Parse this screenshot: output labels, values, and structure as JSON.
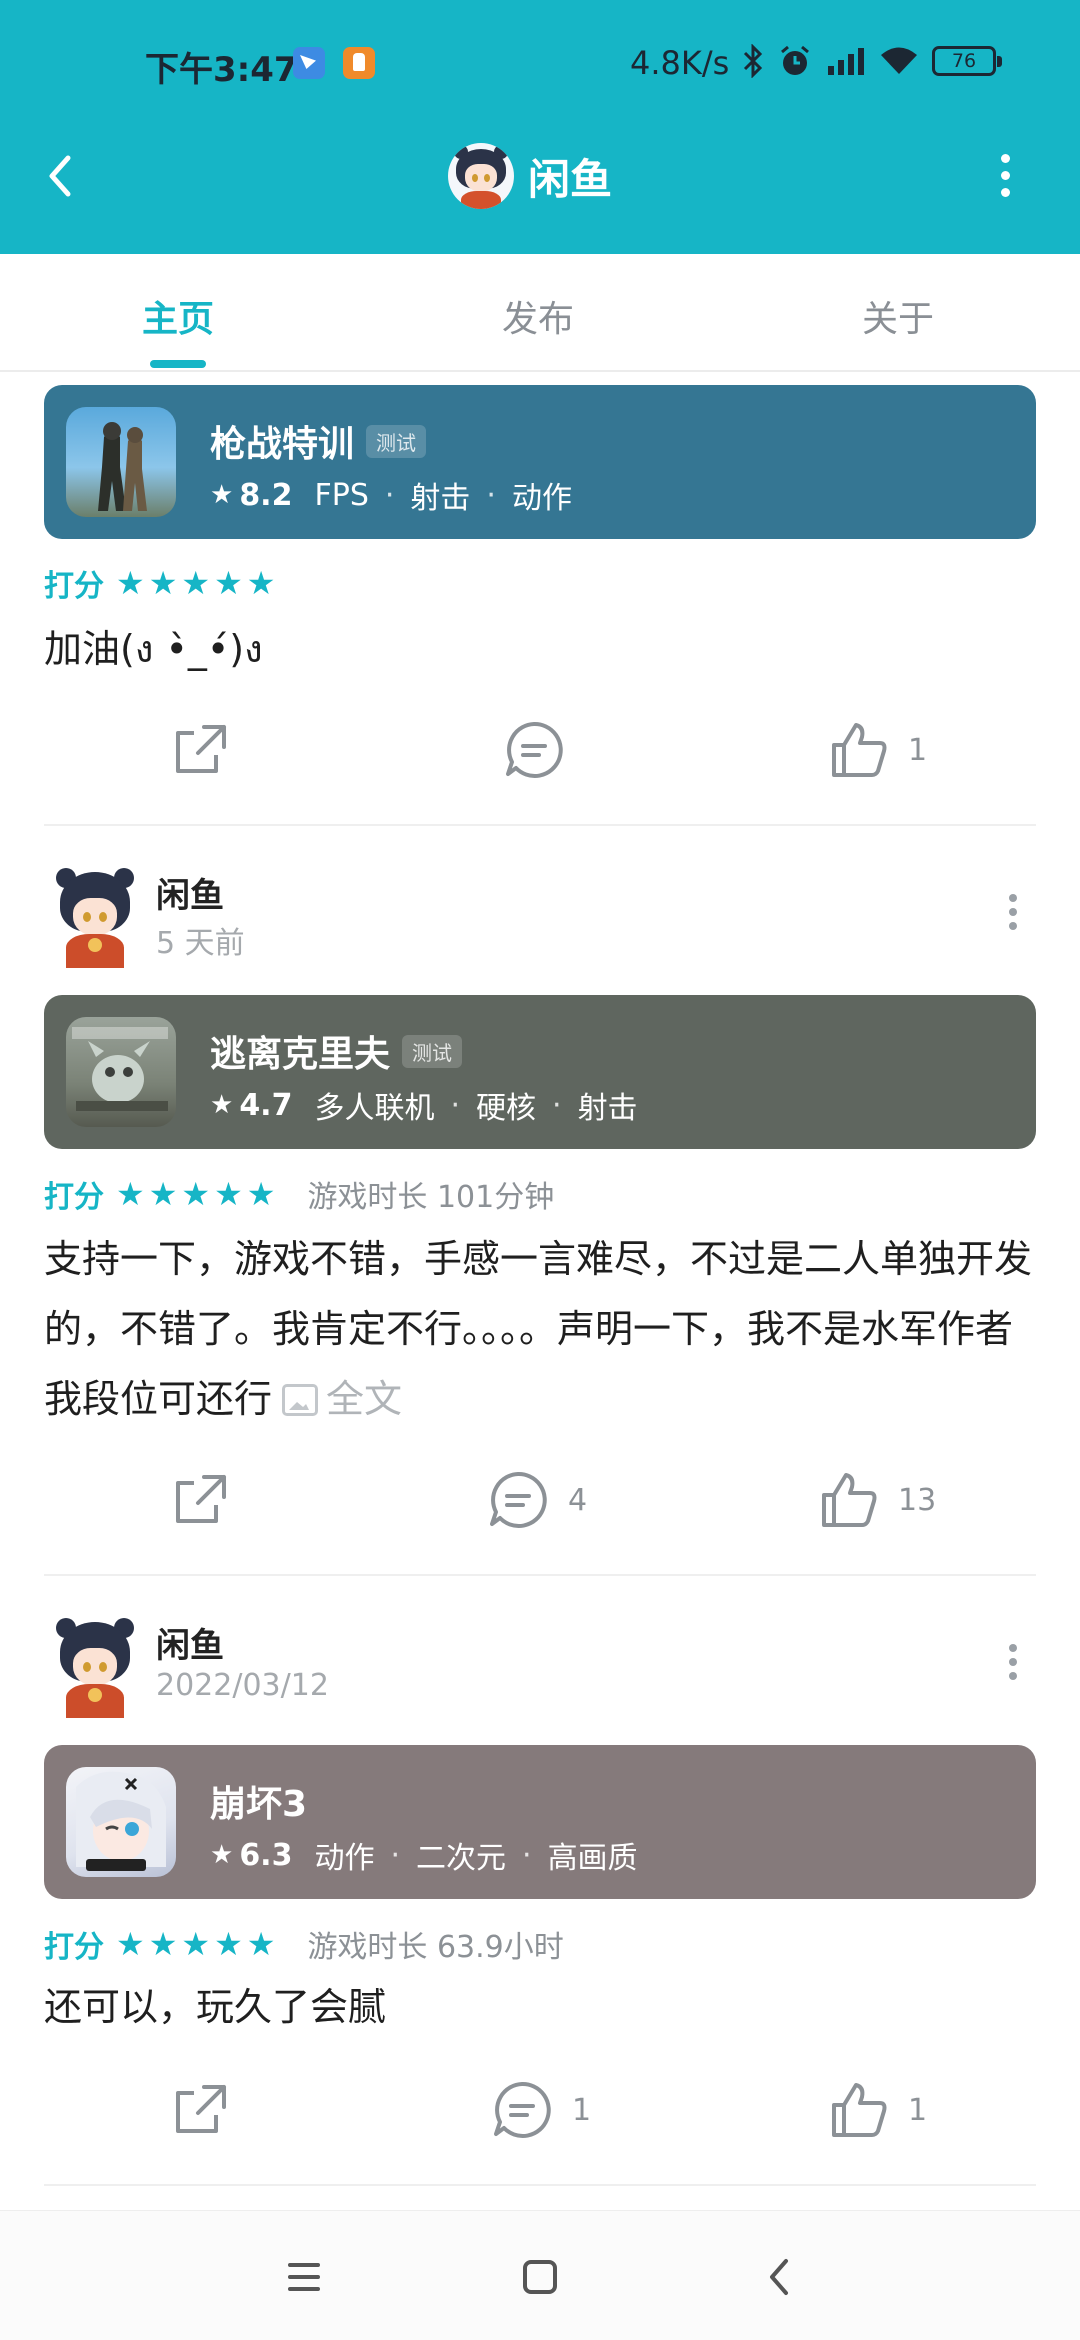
{
  "status": {
    "time": "下午3:47",
    "net_speed": "4.8K/s",
    "battery": "76"
  },
  "header": {
    "title": "闲鱼"
  },
  "tabs": [
    {
      "label": "主页",
      "active": true
    },
    {
      "label": "发布",
      "active": false
    },
    {
      "label": "关于",
      "active": false
    }
  ],
  "posts": [
    {
      "game": {
        "name": "枪战特训",
        "badge": "测试",
        "score": "8.2",
        "tags": [
          "FPS",
          "射击",
          "动作"
        ],
        "card_color": "#357693"
      },
      "rating_label": "打分",
      "stars": 5,
      "content": "加油(ง •̀_•́)ง",
      "actions": {
        "comments": "",
        "likes": "1"
      }
    },
    {
      "user": {
        "name": "闲鱼",
        "time": "5 天前"
      },
      "game": {
        "name": "逃离克里夫",
        "badge": "测试",
        "score": "4.7",
        "tags": [
          "多人联机",
          "硬核",
          "射击"
        ],
        "card_color": "#5f665f"
      },
      "rating_label": "打分",
      "stars": 5,
      "playtime": "游戏时长 101分钟",
      "content": "支持一下，游戏不错，手感一言难尽，不过是二人单独开发的，不错了。我肯定不行。。。。声明一下，我不是水军作者我段位可还行",
      "full_text": "全文",
      "actions": {
        "comments": "4",
        "likes": "13"
      }
    },
    {
      "user": {
        "name": "闲鱼",
        "time": "2022/03/12"
      },
      "game": {
        "name": "崩坏3",
        "badge": "",
        "score": "6.3",
        "tags": [
          "动作",
          "二次元",
          "高画质"
        ],
        "card_color": "#857a7b"
      },
      "rating_label": "打分",
      "stars": 5,
      "playtime": "游戏时长 63.9小时",
      "content": "还可以，玩久了会腻",
      "actions": {
        "comments": "1",
        "likes": "1"
      }
    }
  ],
  "colors": {
    "accent": "#16b5c6"
  }
}
